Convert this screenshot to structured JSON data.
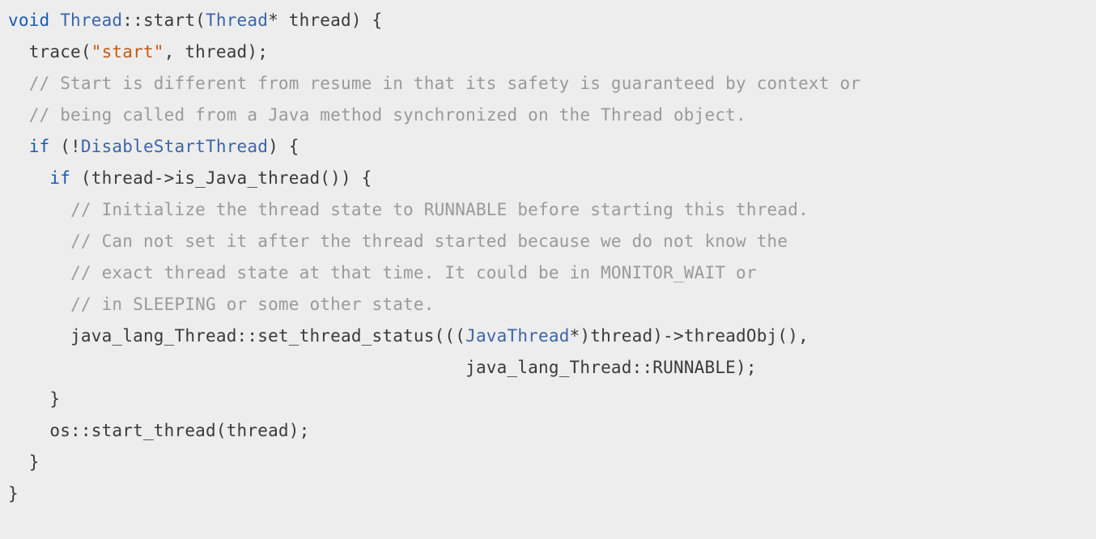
{
  "code": {
    "lines": [
      {
        "indent": 0,
        "tokens": [
          {
            "cls": "kw",
            "t": "void"
          },
          {
            "cls": "def",
            "t": " "
          },
          {
            "cls": "type",
            "t": "Thread"
          },
          {
            "cls": "def",
            "t": "::start("
          },
          {
            "cls": "type",
            "t": "Thread"
          },
          {
            "cls": "def",
            "t": "* thread) {"
          }
        ]
      },
      {
        "indent": 1,
        "tokens": [
          {
            "cls": "def",
            "t": "trace("
          },
          {
            "cls": "str",
            "t": "\"start\""
          },
          {
            "cls": "def",
            "t": ", thread);"
          }
        ]
      },
      {
        "indent": 1,
        "tokens": [
          {
            "cls": "cmt",
            "t": "// Start is different from resume in that its safety is guaranteed by context or"
          }
        ]
      },
      {
        "indent": 1,
        "tokens": [
          {
            "cls": "cmt",
            "t": "// being called from a Java method synchronized on the Thread object."
          }
        ]
      },
      {
        "indent": 1,
        "tokens": [
          {
            "cls": "kw",
            "t": "if"
          },
          {
            "cls": "def",
            "t": " (!"
          },
          {
            "cls": "type",
            "t": "DisableStartThread"
          },
          {
            "cls": "def",
            "t": ") {"
          }
        ]
      },
      {
        "indent": 2,
        "tokens": [
          {
            "cls": "kw",
            "t": "if"
          },
          {
            "cls": "def",
            "t": " (thread->is_Java_thread()) {"
          }
        ]
      },
      {
        "indent": 3,
        "tokens": [
          {
            "cls": "cmt",
            "t": "// Initialize the thread state to RUNNABLE before starting this thread."
          }
        ]
      },
      {
        "indent": 3,
        "tokens": [
          {
            "cls": "cmt",
            "t": "// Can not set it after the thread started because we do not know the"
          }
        ]
      },
      {
        "indent": 3,
        "tokens": [
          {
            "cls": "cmt",
            "t": "// exact thread state at that time. It could be in MONITOR_WAIT or"
          }
        ]
      },
      {
        "indent": 3,
        "tokens": [
          {
            "cls": "cmt",
            "t": "// in SLEEPING or some other state."
          }
        ]
      },
      {
        "indent": 3,
        "tokens": [
          {
            "cls": "def",
            "t": "java_lang_Thread::set_thread_status((("
          },
          {
            "cls": "type",
            "t": "JavaThread"
          },
          {
            "cls": "def",
            "t": "*)thread)->threadObj(),"
          }
        ]
      },
      {
        "indent": 0,
        "leading_spaces": 44,
        "tokens": [
          {
            "cls": "def",
            "t": "java_lang_Thread::RUNNABLE);"
          }
        ]
      },
      {
        "indent": 2,
        "tokens": [
          {
            "cls": "def",
            "t": "}"
          }
        ]
      },
      {
        "indent": 2,
        "tokens": [
          {
            "cls": "def",
            "t": "os::start_thread(thread);"
          }
        ]
      },
      {
        "indent": 1,
        "tokens": [
          {
            "cls": "def",
            "t": "}"
          }
        ]
      },
      {
        "indent": 0,
        "tokens": [
          {
            "cls": "def",
            "t": "}"
          }
        ]
      }
    ],
    "indent_unit": "  "
  }
}
